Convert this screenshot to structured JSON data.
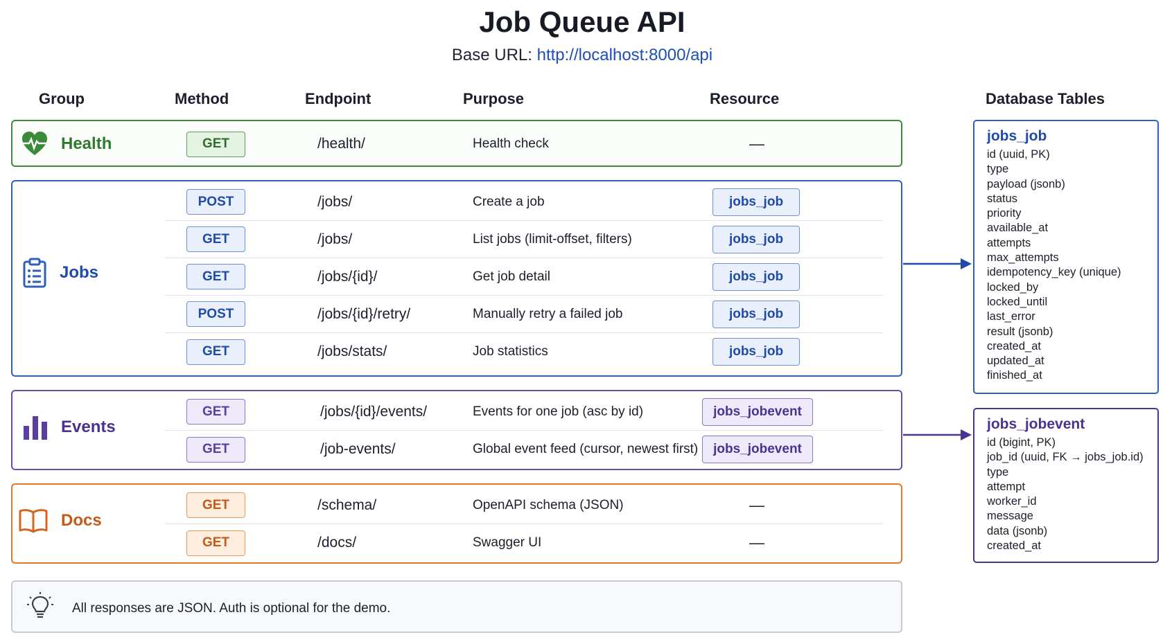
{
  "title": "Job Queue API",
  "subtitle": {
    "prefix": "Base URL: ",
    "url": "http://localhost:8000/api"
  },
  "columns": {
    "group": "Group",
    "method": "Method",
    "endpoint": "Endpoint",
    "purpose": "Purpose",
    "resource": "Resource",
    "db": "Database Tables"
  },
  "colors": {
    "health": "#3f8a3f",
    "jobs": "#2f5fb8",
    "events": "#6a4bb0",
    "docs": "#e07a2a"
  },
  "groups": {
    "health": {
      "label": "Health",
      "icon": "heart-pulse-icon",
      "rows": [
        {
          "method": "GET",
          "endpoint": "/health/",
          "purpose": "Health check",
          "resource": "—"
        }
      ]
    },
    "jobs": {
      "label": "Jobs",
      "icon": "clipboard-list-icon",
      "rows": [
        {
          "method": "POST",
          "endpoint": "/jobs/",
          "purpose": "Create a job",
          "resource": "jobs_job"
        },
        {
          "method": "GET",
          "endpoint": "/jobs/",
          "purpose": "List jobs (limit-offset, filters)",
          "resource": "jobs_job"
        },
        {
          "method": "GET",
          "endpoint": "/jobs/{id}/",
          "purpose": "Get job detail",
          "resource": "jobs_job"
        },
        {
          "method": "POST",
          "endpoint": "/jobs/{id}/retry/",
          "purpose": "Manually retry a failed job",
          "resource": "jobs_job"
        },
        {
          "method": "GET",
          "endpoint": "/jobs/stats/",
          "purpose": "Job statistics",
          "resource": "jobs_job"
        }
      ]
    },
    "events": {
      "label": "Events",
      "icon": "bar-chart-icon",
      "rows": [
        {
          "method": "GET",
          "endpoint": "/jobs/{id}/events/",
          "purpose": "Events for one job (asc by id)",
          "resource": "jobs_jobevent"
        },
        {
          "method": "GET",
          "endpoint": "/job-events/",
          "purpose": "Global event feed (cursor, newest first)",
          "resource": "jobs_jobevent"
        }
      ]
    },
    "docs": {
      "label": "Docs",
      "icon": "open-book-icon",
      "rows": [
        {
          "method": "GET",
          "endpoint": "/schema/",
          "purpose": "OpenAPI schema (JSON)",
          "resource": "—"
        },
        {
          "method": "GET",
          "endpoint": "/docs/",
          "purpose": "Swagger UI",
          "resource": "—"
        }
      ]
    }
  },
  "tables": {
    "jobs_job": {
      "name": "jobs_job",
      "fields": [
        "id (uuid, PK)",
        "type",
        "payload (jsonb)",
        "status",
        "priority",
        "available_at",
        "attempts",
        "max_attempts",
        "idempotency_key (unique)",
        "locked_by",
        "locked_until",
        "last_error",
        "result (jsonb)",
        "created_at",
        "updated_at",
        "finished_at"
      ]
    },
    "jobs_jobevent": {
      "name": "jobs_jobevent",
      "fields": [
        "id (bigint, PK)",
        "job_id (uuid, FK → jobs_job.id)",
        "type",
        "attempt",
        "worker_id",
        "message",
        "data (jsonb)",
        "created_at"
      ]
    }
  },
  "note": {
    "icon": "lightbulb-icon",
    "text": "All responses are JSON. Auth is optional for the demo."
  }
}
